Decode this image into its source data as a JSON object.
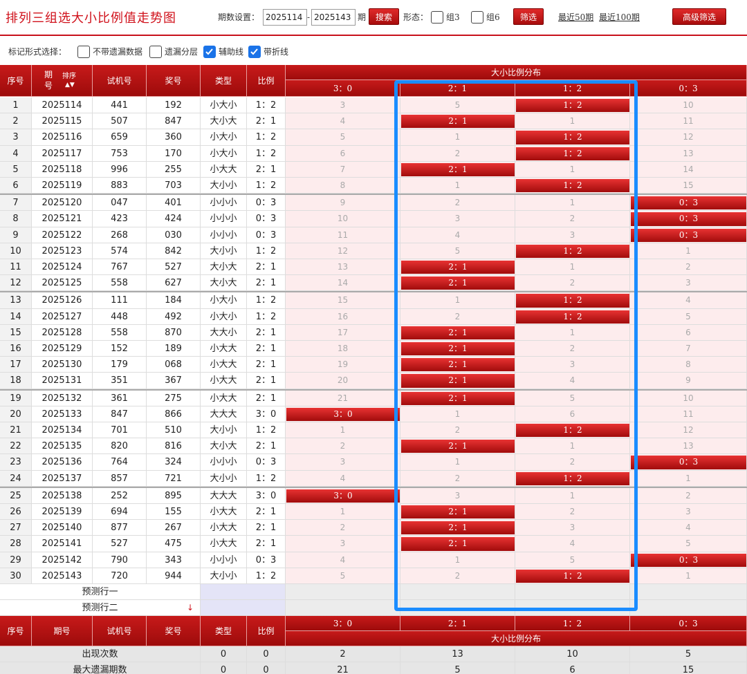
{
  "title": "排列三组选大小比例值走势图",
  "toolbar": {
    "period_label": "期数设置：",
    "start_value": "2025114",
    "dash": "-",
    "end_value": "2025143",
    "period_unit": "期",
    "search_label": "搜索",
    "form_label": "形态：",
    "group3_label": "组3",
    "group6_label": "组6",
    "filter_label": "筛选",
    "recent50_label": "最近50期",
    "recent100_label": "最近100期",
    "advanced_label": "高级筛选"
  },
  "mark": {
    "label": "标记形式选择：",
    "opt1": "不带遗漏数据",
    "opt2": "遗漏分层",
    "opt3": "辅助线",
    "opt4": "带折线",
    "opt1_checked": false,
    "opt2_checked": false,
    "opt3_checked": true,
    "opt4_checked": true
  },
  "header": {
    "seq": "序号",
    "period": "期号",
    "sort_label": "排序",
    "test": "试机号",
    "prize": "奖号",
    "type": "类型",
    "ratio": "比例",
    "dist": "大小比例分布",
    "dist_cols": [
      "3：0",
      "2：1",
      "1：2",
      "0：3"
    ]
  },
  "rows": [
    {
      "seq": "1",
      "period": "2025114",
      "test": "441",
      "prize": "192",
      "type": "小大小",
      "ratio": "1：2",
      "hit": 2,
      "miss": [
        "3",
        "5",
        "",
        "10"
      ]
    },
    {
      "seq": "2",
      "period": "2025115",
      "test": "507",
      "prize": "847",
      "type": "大小大",
      "ratio": "2：1",
      "hit": 1,
      "miss": [
        "4",
        "",
        "1",
        "11"
      ]
    },
    {
      "seq": "3",
      "period": "2025116",
      "test": "659",
      "prize": "360",
      "type": "小大小",
      "ratio": "1：2",
      "hit": 2,
      "miss": [
        "5",
        "1",
        "",
        "12"
      ]
    },
    {
      "seq": "4",
      "period": "2025117",
      "test": "753",
      "prize": "170",
      "type": "小大小",
      "ratio": "1：2",
      "hit": 2,
      "miss": [
        "6",
        "2",
        "",
        "13"
      ]
    },
    {
      "seq": "5",
      "period": "2025118",
      "test": "996",
      "prize": "255",
      "type": "小大大",
      "ratio": "2：1",
      "hit": 1,
      "miss": [
        "7",
        "",
        "1",
        "14"
      ]
    },
    {
      "seq": "6",
      "period": "2025119",
      "test": "883",
      "prize": "703",
      "type": "大小小",
      "ratio": "1：2",
      "hit": 2,
      "miss": [
        "8",
        "1",
        "",
        "15"
      ]
    },
    {
      "seq": "7",
      "period": "2025120",
      "test": "047",
      "prize": "401",
      "type": "小小小",
      "ratio": "0：3",
      "hit": 3,
      "miss": [
        "9",
        "2",
        "1",
        ""
      ]
    },
    {
      "seq": "8",
      "period": "2025121",
      "test": "423",
      "prize": "424",
      "type": "小小小",
      "ratio": "0：3",
      "hit": 3,
      "miss": [
        "10",
        "3",
        "2",
        ""
      ]
    },
    {
      "seq": "9",
      "period": "2025122",
      "test": "268",
      "prize": "030",
      "type": "小小小",
      "ratio": "0：3",
      "hit": 3,
      "miss": [
        "11",
        "4",
        "3",
        ""
      ]
    },
    {
      "seq": "10",
      "period": "2025123",
      "test": "574",
      "prize": "842",
      "type": "大小小",
      "ratio": "1：2",
      "hit": 2,
      "miss": [
        "12",
        "5",
        "",
        "1"
      ]
    },
    {
      "seq": "11",
      "period": "2025124",
      "test": "767",
      "prize": "527",
      "type": "大小大",
      "ratio": "2：1",
      "hit": 1,
      "miss": [
        "13",
        "",
        "1",
        "2"
      ]
    },
    {
      "seq": "12",
      "period": "2025125",
      "test": "558",
      "prize": "627",
      "type": "大小大",
      "ratio": "2：1",
      "hit": 1,
      "miss": [
        "14",
        "",
        "2",
        "3"
      ]
    },
    {
      "seq": "13",
      "period": "2025126",
      "test": "111",
      "prize": "184",
      "type": "小大小",
      "ratio": "1：2",
      "hit": 2,
      "miss": [
        "15",
        "1",
        "",
        "4"
      ]
    },
    {
      "seq": "14",
      "period": "2025127",
      "test": "448",
      "prize": "492",
      "type": "小大小",
      "ratio": "1：2",
      "hit": 2,
      "miss": [
        "16",
        "2",
        "",
        "5"
      ]
    },
    {
      "seq": "15",
      "period": "2025128",
      "test": "558",
      "prize": "870",
      "type": "大大小",
      "ratio": "2：1",
      "hit": 1,
      "miss": [
        "17",
        "",
        "1",
        "6"
      ]
    },
    {
      "seq": "16",
      "period": "2025129",
      "test": "152",
      "prize": "189",
      "type": "小大大",
      "ratio": "2：1",
      "hit": 1,
      "miss": [
        "18",
        "",
        "2",
        "7"
      ]
    },
    {
      "seq": "17",
      "period": "2025130",
      "test": "179",
      "prize": "068",
      "type": "小大大",
      "ratio": "2：1",
      "hit": 1,
      "miss": [
        "19",
        "",
        "3",
        "8"
      ]
    },
    {
      "seq": "18",
      "period": "2025131",
      "test": "351",
      "prize": "367",
      "type": "小大大",
      "ratio": "2：1",
      "hit": 1,
      "miss": [
        "20",
        "",
        "4",
        "9"
      ]
    },
    {
      "seq": "19",
      "period": "2025132",
      "test": "361",
      "prize": "275",
      "type": "小大大",
      "ratio": "2：1",
      "hit": 1,
      "miss": [
        "21",
        "",
        "5",
        "10"
      ]
    },
    {
      "seq": "20",
      "period": "2025133",
      "test": "847",
      "prize": "866",
      "type": "大大大",
      "ratio": "3：0",
      "hit": 0,
      "miss": [
        "",
        "1",
        "6",
        "11"
      ]
    },
    {
      "seq": "21",
      "period": "2025134",
      "test": "701",
      "prize": "510",
      "type": "大小小",
      "ratio": "1：2",
      "hit": 2,
      "miss": [
        "1",
        "2",
        "",
        "12"
      ]
    },
    {
      "seq": "22",
      "period": "2025135",
      "test": "820",
      "prize": "816",
      "type": "大小大",
      "ratio": "2：1",
      "hit": 1,
      "miss": [
        "2",
        "",
        "1",
        "13"
      ]
    },
    {
      "seq": "23",
      "period": "2025136",
      "test": "764",
      "prize": "324",
      "type": "小小小",
      "ratio": "0：3",
      "hit": 3,
      "miss": [
        "3",
        "1",
        "2",
        ""
      ]
    },
    {
      "seq": "24",
      "period": "2025137",
      "test": "857",
      "prize": "721",
      "type": "大小小",
      "ratio": "1：2",
      "hit": 2,
      "miss": [
        "4",
        "2",
        "",
        "1"
      ]
    },
    {
      "seq": "25",
      "period": "2025138",
      "test": "252",
      "prize": "895",
      "type": "大大大",
      "ratio": "3：0",
      "hit": 0,
      "miss": [
        "",
        "3",
        "1",
        "2"
      ]
    },
    {
      "seq": "26",
      "period": "2025139",
      "test": "694",
      "prize": "155",
      "type": "小大大",
      "ratio": "2：1",
      "hit": 1,
      "miss": [
        "1",
        "",
        "2",
        "3"
      ]
    },
    {
      "seq": "27",
      "period": "2025140",
      "test": "877",
      "prize": "267",
      "type": "小大大",
      "ratio": "2：1",
      "hit": 1,
      "miss": [
        "2",
        "",
        "3",
        "4"
      ]
    },
    {
      "seq": "28",
      "period": "2025141",
      "test": "527",
      "prize": "475",
      "type": "小大大",
      "ratio": "2：1",
      "hit": 1,
      "miss": [
        "3",
        "",
        "4",
        "5"
      ]
    },
    {
      "seq": "29",
      "period": "2025142",
      "test": "790",
      "prize": "343",
      "type": "小小小",
      "ratio": "0：3",
      "hit": 3,
      "miss": [
        "4",
        "1",
        "5",
        ""
      ]
    },
    {
      "seq": "30",
      "period": "2025143",
      "test": "720",
      "prize": "944",
      "type": "大小小",
      "ratio": "1：2",
      "hit": 2,
      "miss": [
        "5",
        "2",
        "",
        "1"
      ]
    }
  ],
  "predict": {
    "row1": "预测行一",
    "row2": "预测行二"
  },
  "stats": [
    {
      "label": "出现次数",
      "type": "0",
      "ratio": "0",
      "vals": [
        "2",
        "13",
        "10",
        "5"
      ]
    },
    {
      "label": "最大遗漏期数",
      "type": "0",
      "ratio": "0",
      "vals": [
        "21",
        "5",
        "6",
        "15"
      ]
    }
  ],
  "colors": {
    "brand_red": "#c8101a",
    "highlight_blue": "#1a8cff",
    "check_blue": "#1a73e8"
  }
}
